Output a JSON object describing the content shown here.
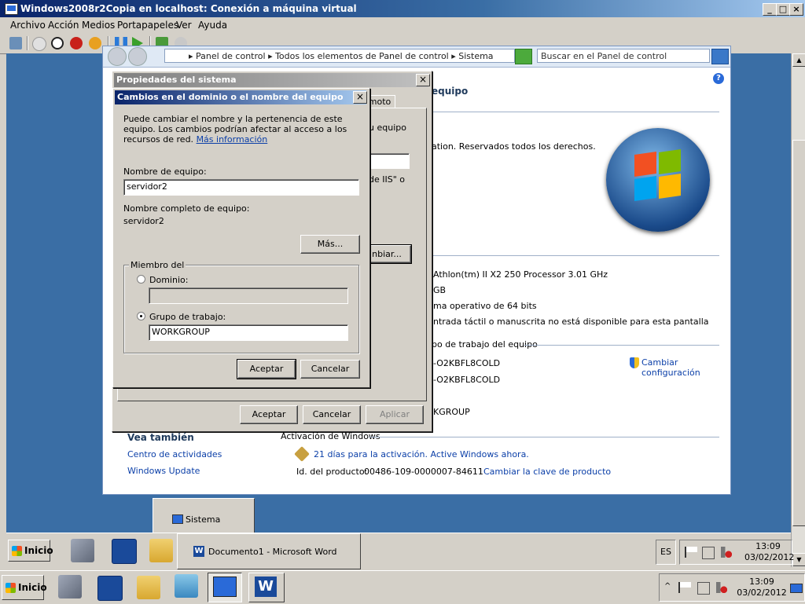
{
  "host": {
    "title": "Windows2008r2Copia en localhost: Conexión a máquina virtual",
    "menu": [
      "Archivo",
      "Acción",
      "Medios",
      "Portapapeles",
      "Ver",
      "Ayuda"
    ],
    "window_buttons": [
      "_",
      "□",
      "×"
    ]
  },
  "control_panel": {
    "breadcrumb": "▸ Panel de control ▸ Todos los elementos de Panel de control ▸ Sistema",
    "search_placeholder": "Buscar en el Panel de control",
    "heading_fragment": "equipo",
    "copyright_fragment": "ation. Reservados todos los derechos.",
    "processor_fragment": "Athlon(tm) II X2 250 Processor   3.01 GHz",
    "ram_fragment": "GB",
    "os_type_fragment": "ma operativo de 64 bits",
    "pen_fragment": "ntrada táctil o manuscrita no está disponible para esta pantalla",
    "section_workgroup": "po de trabajo del equipo",
    "computer_name_fragment": "-O2KBFL8COLD",
    "full_name_fragment": "-O2KBFL8COLD",
    "workgroup_fragment": "KGROUP",
    "change_settings_link": "Cambiar configuración",
    "see_also_title": "Vea también",
    "see_also_links": [
      "Centro de actividades",
      "Windows Update"
    ],
    "activation_section": "Activación de Windows",
    "activation_text": "21 días para la activación. Active Windows ahora.",
    "product_id_label": "Id. del producto:",
    "product_id_value": "00486-109-0000007-84611",
    "change_key_link": "Cambiar la clave de producto"
  },
  "system_props": {
    "title": "Propiedades del sistema",
    "tab_fragment": "emoto",
    "text1_fragment": "u equipo",
    "text2_fragment": "de IIS\" o",
    "change_btn_fragment": "nbiar...",
    "ok": "Aceptar",
    "cancel": "Cancelar",
    "apply": "Aplicar"
  },
  "change_dialog": {
    "title": "Cambios en el dominio o el nombre del equipo",
    "description": "Puede cambiar el nombre y la pertenencia de este equipo. Los cambios podrían afectar al acceso a los recursos de red.",
    "more_info_link": "Más información",
    "computer_name_label": "Nombre de equipo:",
    "computer_name_value": "servidor2",
    "full_name_label": "Nombre completo de equipo:",
    "full_name_value": "servidor2",
    "more_button": "Más...",
    "member_of_label": "Miembro del",
    "domain_label": "Dominio:",
    "domain_value": "",
    "workgroup_label": "Grupo de trabajo:",
    "workgroup_value": "WORKGROUP",
    "selected_membership": "workgroup",
    "ok": "Aceptar",
    "cancel": "Cancelar"
  },
  "vm_taskbar": {
    "start": "Inicio",
    "sistema_popup": "Sistema",
    "task_word": "Documento1 - Microsoft Word",
    "lang": "ES",
    "time": "13:09",
    "date": "03/02/2012"
  },
  "host_taskbar": {
    "start": "Inicio",
    "time": "13:09",
    "date": "03/02/2012"
  }
}
